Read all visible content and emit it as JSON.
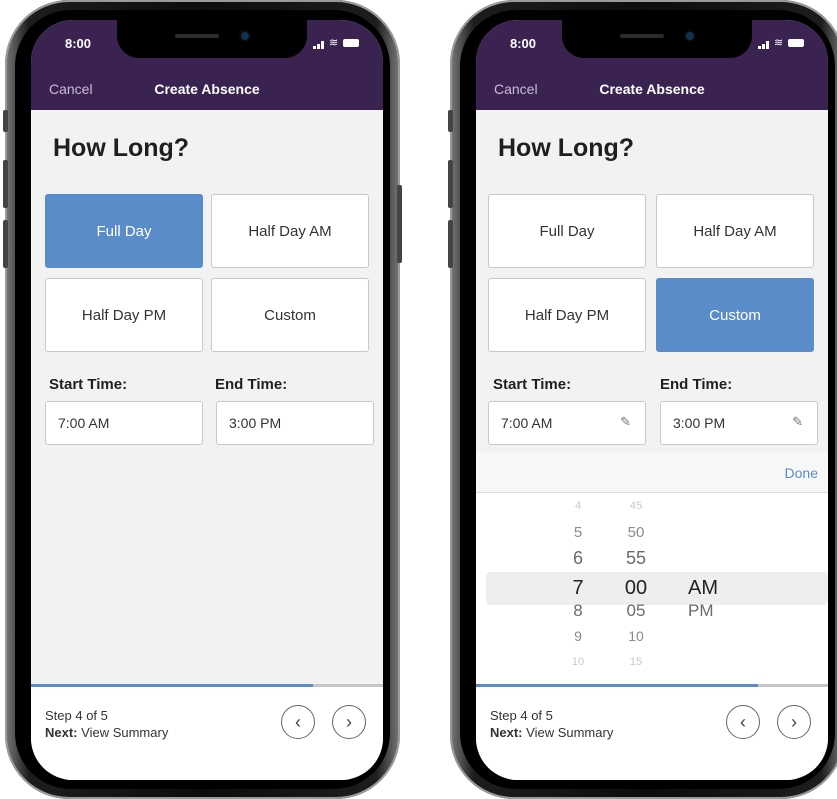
{
  "common": {
    "time": "8:00",
    "nav": {
      "cancel": "Cancel",
      "title": "Create Absence"
    },
    "heading": "How Long?",
    "options": {
      "full_day": "Full Day",
      "half_am": "Half Day AM",
      "half_pm": "Half Day PM",
      "custom": "Custom"
    },
    "start_label": "Start Time:",
    "end_label": "End Time:",
    "start_value": "7:00 AM",
    "end_value": "3:00 PM",
    "step": "Step 4 of 5",
    "next_prefix": "Next:",
    "next_value": "View Summary",
    "progress_fraction": 0.8,
    "prev_icon": "chevron-left-icon",
    "next_icon": "chevron-right-icon"
  },
  "left_screen": {
    "selected_option": "Full Day"
  },
  "right_screen": {
    "selected_option": "Custom",
    "picker": {
      "done": "Done",
      "hours": [
        "4",
        "5",
        "6",
        "7",
        "8",
        "9",
        "10"
      ],
      "minutes": [
        "45",
        "50",
        "55",
        "00",
        "05",
        "10",
        "15"
      ],
      "ampm": [
        "AM",
        "PM"
      ],
      "selected": {
        "hour": "7",
        "minute": "00",
        "ampm": "AM"
      }
    }
  },
  "colors": {
    "header": "#3b2351",
    "accent": "#5a8cc9",
    "background": "#f2f2f2"
  }
}
